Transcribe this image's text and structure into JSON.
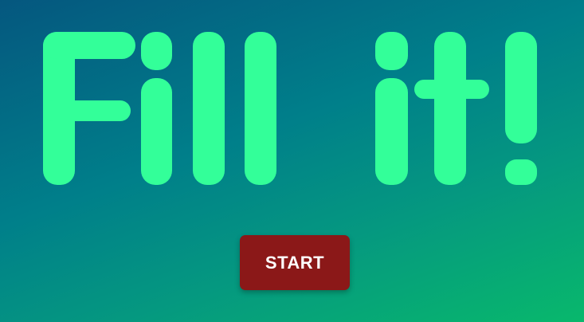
{
  "game": {
    "title": "Fill it!",
    "start_label": "START"
  },
  "colors": {
    "title": "#33ff99",
    "start_button": "#8b1818",
    "start_text": "#ffffff",
    "background_start": "#05577f",
    "background_end": "#08b86c"
  }
}
